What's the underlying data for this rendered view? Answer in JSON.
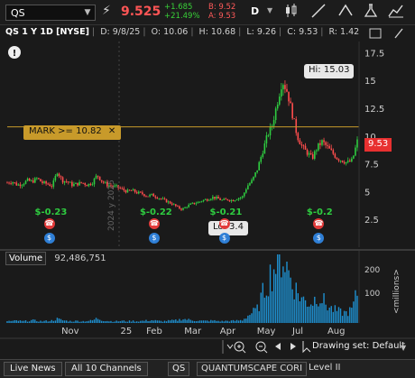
{
  "toolbar": {
    "symbol": "QS",
    "last": "9.525",
    "change_abs": "+1.685",
    "change_pct": "+21.49%",
    "bid": "B: 9.52",
    "ask": "A: 9.53",
    "aggregation": "D"
  },
  "header": {
    "title": "QS 1 Y 1D [NYSE]",
    "date": "D: 9/8/25",
    "open": "O: 10.06",
    "high": "H: 10.68",
    "low": "L: 9.26",
    "close": "C: 9.53",
    "range": "R: 1.42"
  },
  "chart": {
    "price_axis": [
      "17.5",
      "15",
      "12.5",
      "10",
      "7.5",
      "5",
      "2.5"
    ],
    "price_label": "9.53",
    "hi_label": "Hi: 15.03",
    "lo_label": "Lo: 3.4",
    "mark_label": "MARK >= 10.82",
    "mark_close": "✕",
    "year_label": "2024 y 2025",
    "dividend_labels": [
      "$-0.23",
      "$-0.22",
      "$-0.21",
      "$-0.2"
    ],
    "volume_label": "Volume",
    "volume_value": "92,486,751",
    "volume_axis": [
      "200",
      "100"
    ],
    "volume_unit": "<millions>",
    "x_labels": [
      "Nov",
      "25",
      "Feb",
      "Mar",
      "Apr",
      "May",
      "Jul",
      "Aug"
    ],
    "colors": {
      "up": "#2ecc40",
      "down": "#ff4d4d",
      "mark": "#c89a2a",
      "volume": "#1e90d0",
      "price_tag": "#e83030"
    }
  },
  "chart_data": {
    "type": "candlestick",
    "title": "QS 1 Y 1D [NYSE]",
    "ylim": [
      0,
      18.5
    ],
    "ticks": [
      2.5,
      5,
      7.5,
      10,
      12.5,
      15,
      17.5
    ],
    "series": [
      {
        "name": "close",
        "values": [
          5.8,
          5.9,
          5.6,
          5.7,
          6.0,
          5.9,
          6.2,
          5.8,
          5.7,
          5.5,
          6.8,
          6.0,
          5.9,
          5.6,
          5.7,
          5.8,
          5.6,
          5.8,
          6.5,
          5.9,
          5.6,
          5.5,
          5.4,
          5.2,
          5.0,
          5.1,
          4.9,
          4.8,
          4.6,
          4.7,
          4.5,
          4.3,
          4.1,
          3.9,
          3.6,
          3.4,
          3.7,
          3.9,
          4.0,
          4.2,
          4.3,
          4.5,
          4.4,
          4.2,
          4.3,
          4.2,
          4.4,
          4.5,
          5.5,
          6.0,
          7.0,
          8.5,
          10.0,
          11.0,
          13.0,
          15.0,
          14.0,
          12.0,
          10.0,
          9.0,
          8.5,
          8.0,
          9.0,
          9.5,
          9.0,
          8.5,
          8.0,
          7.8,
          7.6,
          7.8,
          9.53
        ]
      }
    ],
    "hi": 15.03,
    "lo": 3.4,
    "last": 9.53,
    "mark": 10.82,
    "volume_ylim": [
      0,
      210
    ],
    "volume_values": [
      6,
      5,
      7,
      5,
      6,
      8,
      6,
      5,
      6,
      7,
      12,
      8,
      6,
      5,
      6,
      5,
      6,
      7,
      14,
      8,
      6,
      5,
      5,
      6,
      5,
      6,
      5,
      6,
      7,
      8,
      6,
      5,
      6,
      7,
      8,
      12,
      10,
      8,
      7,
      6,
      6,
      7,
      6,
      5,
      6,
      6,
      7,
      8,
      20,
      30,
      40,
      80,
      120,
      150,
      180,
      200,
      160,
      120,
      90,
      70,
      60,
      60,
      80,
      70,
      50,
      40,
      35,
      30,
      30,
      40,
      90
    ]
  },
  "bottom": {
    "drawing_set": "Drawing set: Default"
  },
  "status": {
    "live_news": "Live News",
    "channels": "All 10 Channels",
    "symbol": "QS",
    "company": "QUANTUMSCAPE CORI",
    "level": "Level II"
  }
}
